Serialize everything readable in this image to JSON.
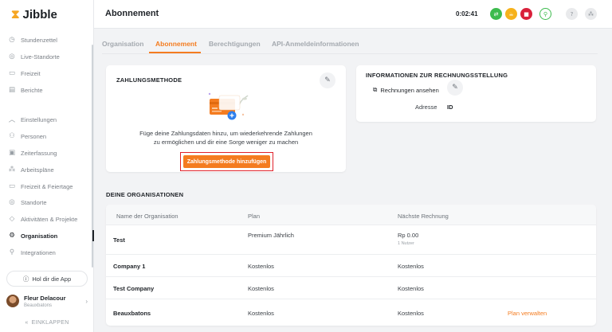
{
  "app": {
    "logo_text": "Jibble"
  },
  "sidebar": {
    "items": [
      {
        "label": "Stundenzettel",
        "icon": "clock-icon"
      },
      {
        "label": "Live-Standorte",
        "icon": "location-pin-icon"
      },
      {
        "label": "Freizeit",
        "icon": "calendar-icon"
      },
      {
        "label": "Berichte",
        "icon": "report-icon"
      },
      {
        "label": "Einstellungen",
        "icon": "chevron-up-icon"
      },
      {
        "label": "Personen",
        "icon": "people-icon"
      },
      {
        "label": "Zeiterfassung",
        "icon": "time-tracking-icon"
      },
      {
        "label": "Arbeitspläne",
        "icon": "schedule-icon"
      },
      {
        "label": "Freizeit & Feiertage",
        "icon": "holiday-icon"
      },
      {
        "label": "Standorte",
        "icon": "location-icon"
      },
      {
        "label": "Aktivitäten & Projekte",
        "icon": "tag-icon"
      },
      {
        "label": "Organisation",
        "icon": "gear-icon",
        "active": true
      },
      {
        "label": "Integrationen",
        "icon": "plug-icon"
      }
    ],
    "app_button": "Hol dir die App",
    "user": {
      "name": "Fleur Delacour",
      "org": "Beauxbatons"
    },
    "collapse_label": "EINKLAPPEN"
  },
  "header": {
    "title": "Abonnement",
    "timer": "0:02:41",
    "colors": {
      "green": "#3dbb4e",
      "yellow": "#f6b21b",
      "red": "#d9213b"
    }
  },
  "tabs": [
    {
      "label": "Organisation"
    },
    {
      "label": "Abonnement",
      "active": true
    },
    {
      "label": "Berechtigungen"
    },
    {
      "label": "API-Anmeldeinformationen"
    }
  ],
  "payment": {
    "title": "ZAHLUNGSMETHODE",
    "desc_line1": "Füge deine Zahlungsdaten hinzu, um wiederkehrende Zahlungen",
    "desc_line2": "zu ermöglichen und dir eine Sorge weniger zu machen",
    "button_label": "Zahlungsmethode hinzufügen",
    "accent": "#f47c20"
  },
  "billing": {
    "title": "INFORMATIONEN ZUR RECHNUNGSSTELLUNG",
    "view_invoices": "Rechnungen ansehen",
    "address_label": "Adresse",
    "address_value": "ID"
  },
  "organisations": {
    "title": "DEINE ORGANISATIONEN",
    "columns": [
      "Name der Organisation",
      "Plan",
      "Nächste Rechnung"
    ],
    "rows": [
      {
        "name": "Test",
        "plan": "Premium Jährlich",
        "next": "Rp 0.00",
        "next_sub": "1 Nutzer",
        "action": ""
      },
      {
        "name": "Company 1",
        "plan": "Kostenlos",
        "next": "Kostenlos",
        "next_sub": "",
        "action": ""
      },
      {
        "name": "Test Company",
        "plan": "Kostenlos",
        "next": "Kostenlos",
        "next_sub": "",
        "action": ""
      },
      {
        "name": "Beauxbatons",
        "plan": "Kostenlos",
        "next": "Kostenlos",
        "next_sub": "",
        "action": "Plan verwalten"
      }
    ]
  }
}
